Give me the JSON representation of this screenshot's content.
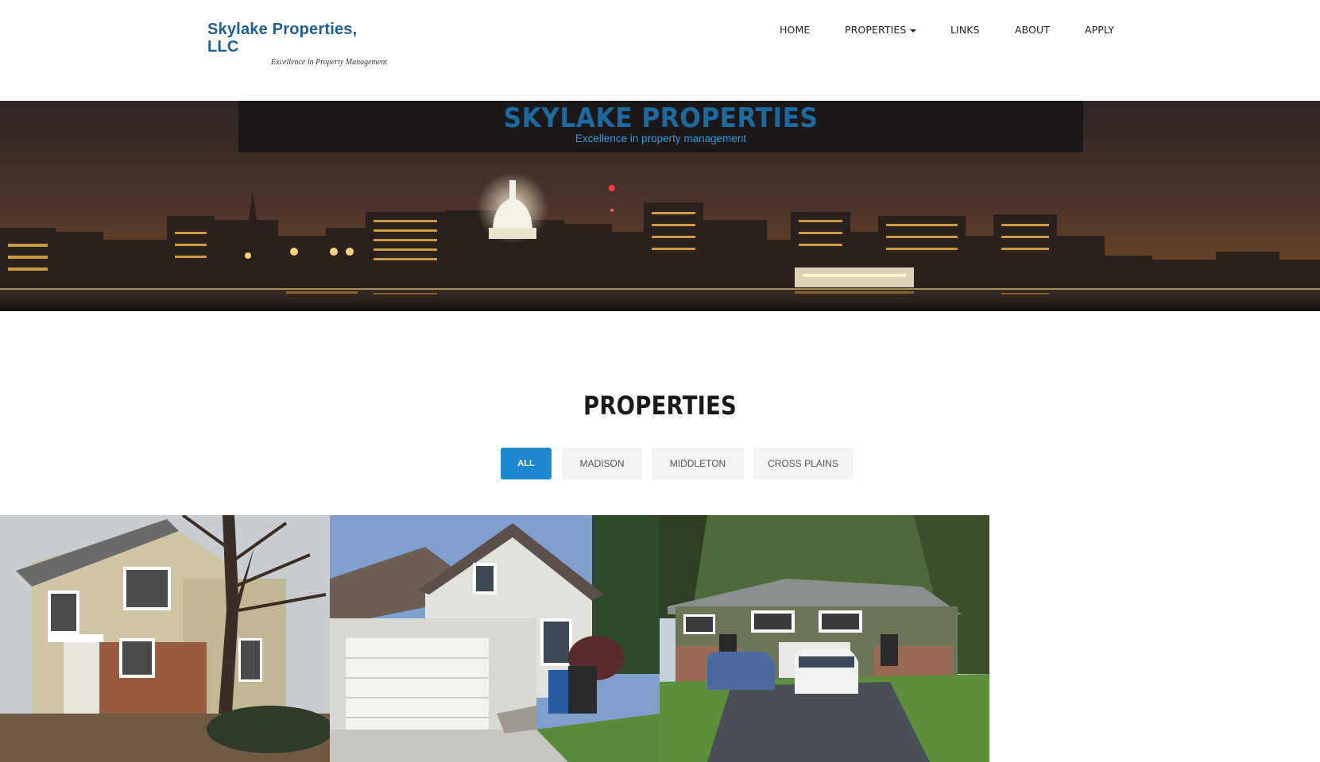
{
  "header": {
    "logo_title": "Skylake Properties, LLC",
    "logo_tagline": "Excellence in Property Management",
    "nav": [
      {
        "label": "HOME"
      },
      {
        "label": "PROPERTIES",
        "has_dropdown": true
      },
      {
        "label": "LINKS"
      },
      {
        "label": "ABOUT"
      },
      {
        "label": "APPLY"
      }
    ]
  },
  "hero": {
    "title": "SKYLAKE PROPERTIES",
    "subtitle": "Excellence in property management"
  },
  "properties": {
    "heading": "PROPERTIES",
    "filters": [
      {
        "label": "ALL",
        "active": true
      },
      {
        "label": "MADISON",
        "active": false
      },
      {
        "label": "MIDDLETON",
        "active": false
      },
      {
        "label": "CROSS PLAINS",
        "active": false
      }
    ],
    "photos": [
      {
        "name": "property-photo-1"
      },
      {
        "name": "property-photo-2"
      },
      {
        "name": "property-photo-3"
      }
    ]
  },
  "colors": {
    "brand_blue": "#1d5e8e",
    "hero_title": "#1d6aa0",
    "hero_subtitle": "#2f9be0",
    "active_filter": "#1e88cf",
    "filter_bg": "#f3f3f3"
  }
}
